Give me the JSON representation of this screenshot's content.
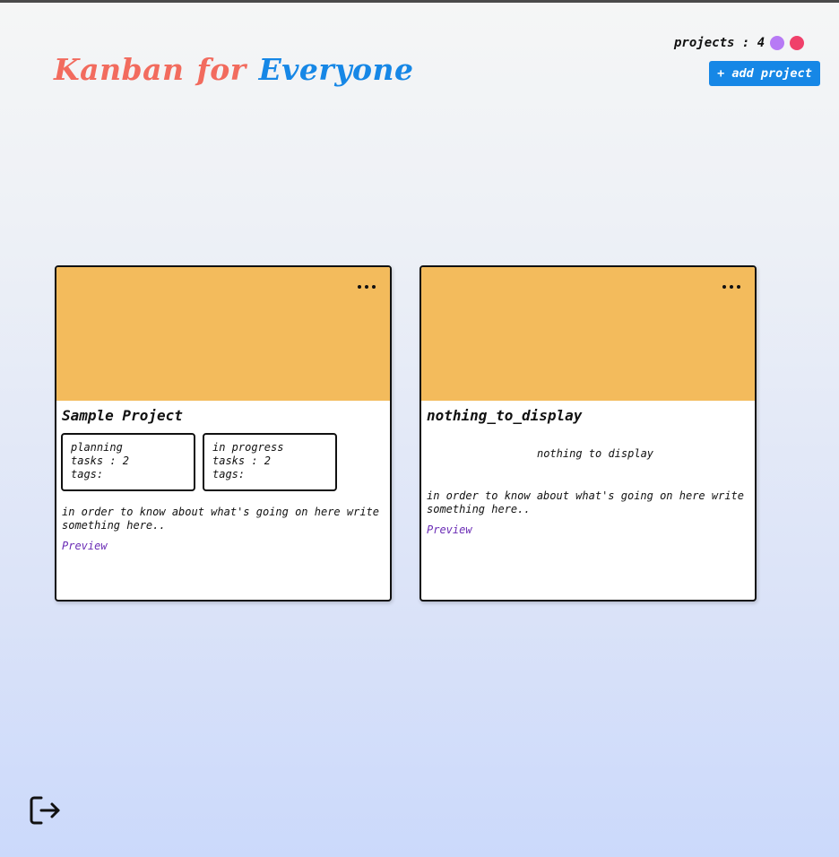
{
  "brand": {
    "word1": "Kanban",
    "word2": "for",
    "word3": "Everyone"
  },
  "header": {
    "projects_label": "projects : 4",
    "add_project_label": "+ add project"
  },
  "colors": {
    "accent_blue": "#1687e6",
    "brand_coral": "#f26b5e",
    "banner": "#f3bb5c",
    "dot_purple": "#b77af5",
    "dot_pink": "#f0406a",
    "link_purple": "#6a2bb5"
  },
  "projects": [
    {
      "title": "Sample Project",
      "columns": [
        {
          "name": "planning",
          "tasks": "tasks : 2",
          "tags": "tags:"
        },
        {
          "name": "in progress",
          "tasks": "tasks : 2",
          "tags": "tags:"
        }
      ],
      "description": "in order to know about what's going on here write something here..",
      "preview_label": "Preview"
    },
    {
      "title": "nothing_to_display",
      "empty_message": "nothing to display",
      "description": "in order to know about what's going on here write something here..",
      "preview_label": "Preview"
    }
  ],
  "icons": {
    "menu": "more-horizontal-icon",
    "logout": "logout-icon"
  }
}
